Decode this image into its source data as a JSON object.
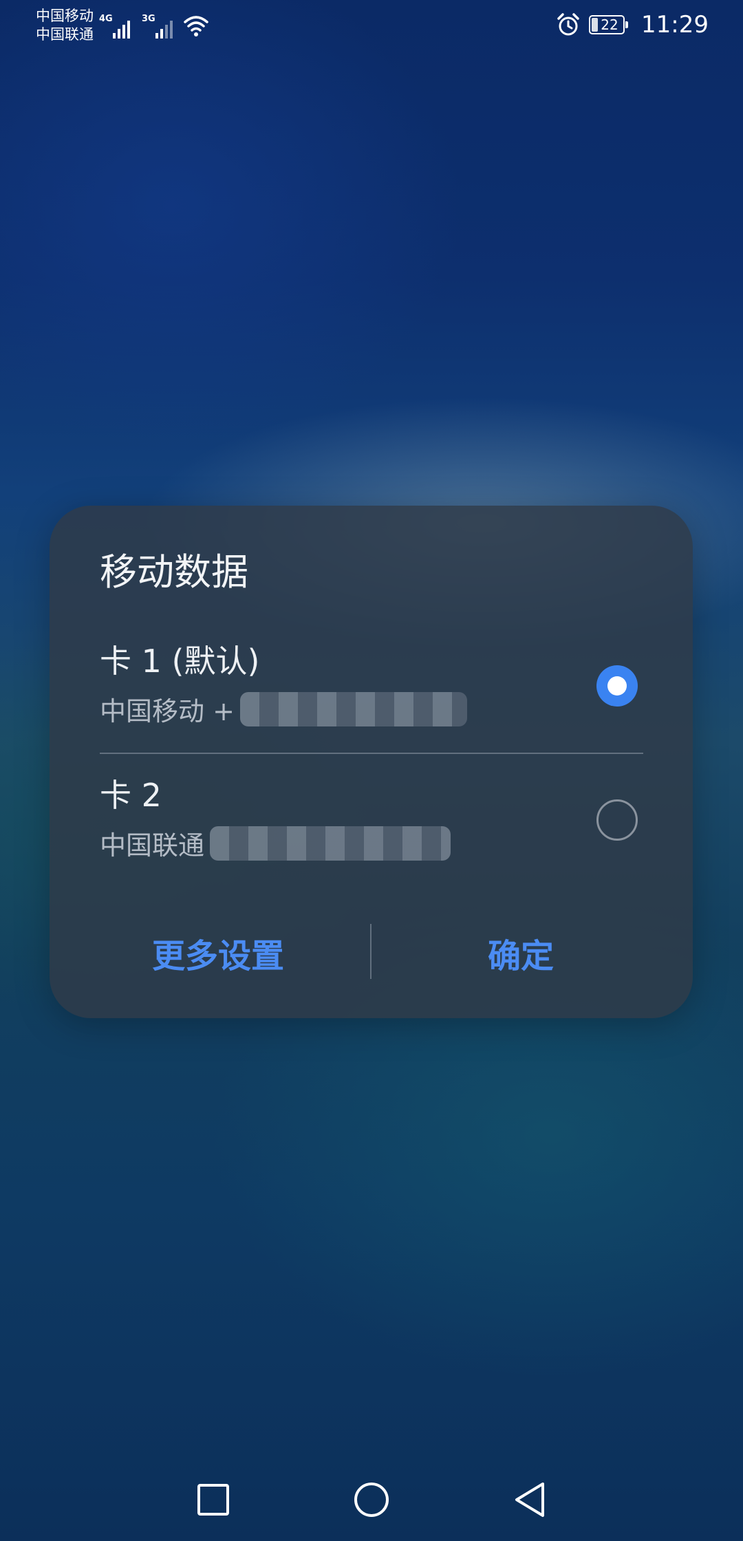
{
  "status_bar": {
    "carrier_1": "中国移动",
    "carrier_2": "中国联通",
    "network_1": "4G",
    "network_2": "3G",
    "battery_level": "22",
    "time": "11:29",
    "icons": [
      "signal-icon",
      "wifi-icon",
      "alarm-icon",
      "battery-icon"
    ]
  },
  "dialog": {
    "title": "移动数据",
    "options": [
      {
        "label": "卡 1 (默认)",
        "carrier": "中国移动 +",
        "selected": true
      },
      {
        "label": "卡 2",
        "carrier": "中国联通",
        "selected": false
      }
    ],
    "buttons": {
      "more_settings": "更多设置",
      "confirm": "确定"
    },
    "colors": {
      "accent": "#3a83f1",
      "button_text": "#4b8cf3"
    }
  },
  "nav_bar": {
    "icons": [
      "recent-apps-icon",
      "home-icon",
      "back-icon"
    ]
  }
}
